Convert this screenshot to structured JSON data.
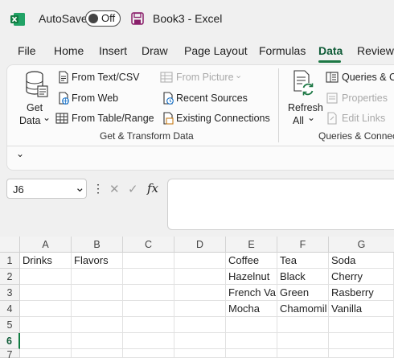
{
  "titlebar": {
    "autosave_label": "AutoSave",
    "autosave_state": "Off",
    "doc_title": "Book3  -  Excel"
  },
  "menu": {
    "tabs": [
      "File",
      "Home",
      "Insert",
      "Draw",
      "Page Layout",
      "Formulas",
      "Data",
      "Review"
    ],
    "active": "Data"
  },
  "ribbon": {
    "get_data": {
      "line1": "Get",
      "line2": "Data",
      "chevron": "⌄"
    },
    "from_text_csv": "From Text/CSV",
    "from_web": "From Web",
    "from_table_range": "From Table/Range",
    "from_picture": "From Picture",
    "recent_sources": "Recent Sources",
    "existing_connections": "Existing Connections",
    "group1_label": "Get & Transform Data",
    "refresh": {
      "line1": "Refresh",
      "line2": "All"
    },
    "queries_connections": "Queries & C",
    "properties": "Properties",
    "edit_links": "Edit Links",
    "group2_label": "Queries & Connec",
    "collapse_glyph": "⌄"
  },
  "formula_bar": {
    "name_box": "J6",
    "chevron": "⌄",
    "more": "⋮",
    "cancel": "✕",
    "enter": "✓",
    "fx": "fx",
    "content": ""
  },
  "sheet": {
    "columns": [
      "A",
      "B",
      "C",
      "D",
      "E",
      "F",
      "G"
    ],
    "rows": [
      "1",
      "2",
      "3",
      "4",
      "5",
      "6",
      "7"
    ],
    "selected_row": "6",
    "cells": {
      "A1": "Drinks",
      "B1": "Flavors",
      "E1": "Coffee",
      "F1": "Tea",
      "G1": "Soda",
      "E2": "Hazelnut",
      "F2": "Black",
      "G2": "Cherry",
      "E3": "French Va",
      "F3": "Green",
      "G3": "Rasberry",
      "E4": "Mocha",
      "F4": "Chamomil",
      "G4": "Vanilla"
    }
  },
  "colors": {
    "accent": "#107c41",
    "excel_green": "#1d6f42"
  }
}
